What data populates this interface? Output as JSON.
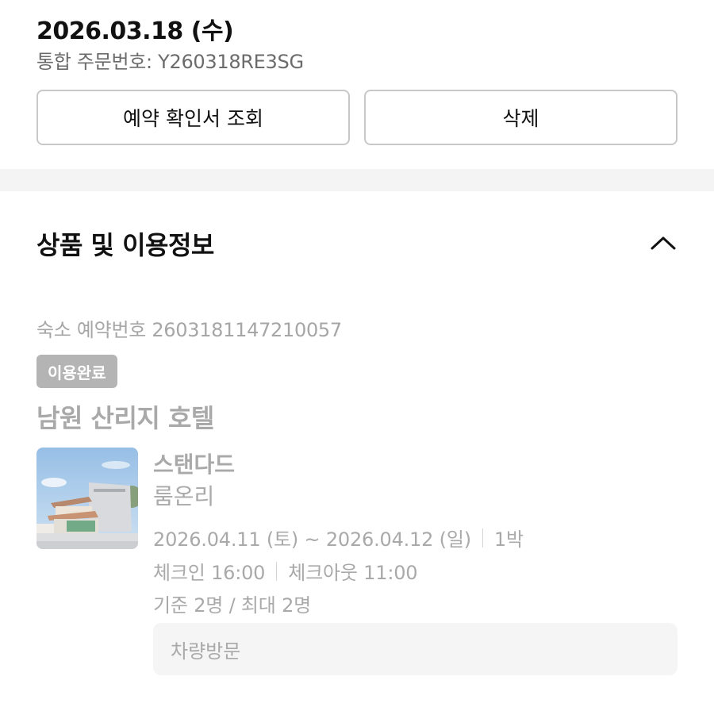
{
  "order": {
    "date": "2026.03.18 (수)",
    "number_label": "통합 주문번호: Y260318RE3SG",
    "confirm_button": "예약 확인서 조회",
    "delete_button": "삭제"
  },
  "section": {
    "title": "상품 및 이용정보",
    "toggle_icon": "chevron-up-icon"
  },
  "reservation": {
    "number_label": "숙소 예약번호 2603181147210057",
    "status": "이용완료",
    "hotel_name": "남원 산리지 호텔",
    "room_type": "스탠다드",
    "room_option": "룸온리",
    "stay_dates": "2026.04.11 (토) ~ 2026.04.12 (일)",
    "nights": "1박",
    "checkin": "체크인 16:00",
    "checkout": "체크아웃 11:00",
    "occupancy": "기준 2명 / 최대 2명",
    "visit_method": "차량방문"
  },
  "colors": {
    "badge_bg": "#b4b4b4",
    "muted_text": "#a9a9a9",
    "button_border": "#c8c8c8"
  }
}
